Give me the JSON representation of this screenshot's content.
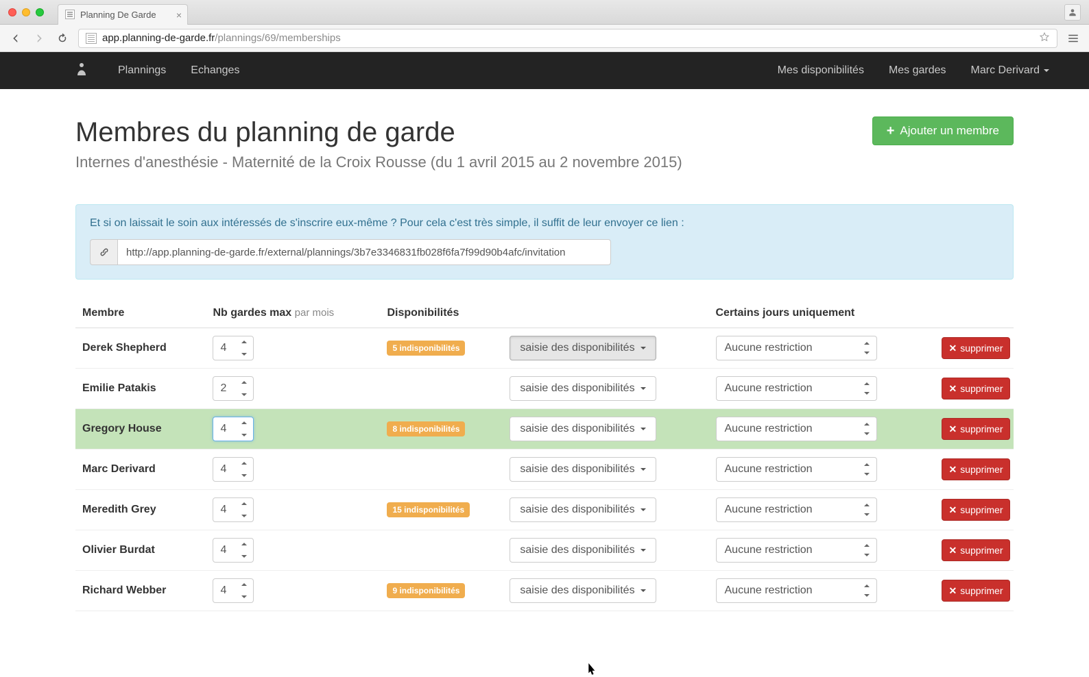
{
  "browser": {
    "tab_title": "Planning De Garde",
    "url_host": "app.planning-de-garde.fr",
    "url_path": "/plannings/69/memberships"
  },
  "nav": {
    "plannings": "Plannings",
    "echanges": "Echanges",
    "mes_dispos": "Mes disponibilités",
    "mes_gardes": "Mes gardes",
    "user_name": "Marc Derivard"
  },
  "header": {
    "title": "Membres du planning de garde",
    "subtitle": "Internes d'anesthésie - Maternité de la Croix Rousse (du 1 avril 2015 au 2 novembre 2015)",
    "add_member": "Ajouter un membre"
  },
  "invite_box": {
    "text": "Et si on laissait le soin aux intéressés de s'inscrire eux-même ? Pour cela c'est très simple, il suffit de leur envoyer ce lien :",
    "url": "http://app.planning-de-garde.fr/external/plannings/3b7e3346831fb028f6fa7f99d90b4afc/invitation"
  },
  "table": {
    "cols": {
      "member": "Membre",
      "nb_gardes": "Nb gardes max",
      "nb_gardes_suffix": "par mois",
      "dispos": "Disponibilités",
      "restrict": "Certains jours uniquement"
    },
    "dropdown_label": "saisie des disponibilités",
    "restrict_default": "Aucune restriction",
    "delete_label": "supprimer",
    "rows": [
      {
        "name": "Derek Shepherd",
        "nb": "4",
        "badge": "5 indisponibilités",
        "highlight": false,
        "dd_active": true,
        "nb_focus": false
      },
      {
        "name": "Emilie Patakis",
        "nb": "2",
        "badge": "",
        "highlight": false,
        "dd_active": false,
        "nb_focus": false
      },
      {
        "name": "Gregory House",
        "nb": "4",
        "badge": "8 indisponibilités",
        "highlight": true,
        "dd_active": false,
        "nb_focus": true
      },
      {
        "name": "Marc Derivard",
        "nb": "4",
        "badge": "",
        "highlight": false,
        "dd_active": false,
        "nb_focus": false
      },
      {
        "name": "Meredith Grey",
        "nb": "4",
        "badge": "15 indisponibilités",
        "highlight": false,
        "dd_active": false,
        "nb_focus": false
      },
      {
        "name": "Olivier Burdat",
        "nb": "4",
        "badge": "",
        "highlight": false,
        "dd_active": false,
        "nb_focus": false
      },
      {
        "name": "Richard Webber",
        "nb": "4",
        "badge": "9 indisponibilités",
        "highlight": false,
        "dd_active": false,
        "nb_focus": false
      }
    ]
  }
}
